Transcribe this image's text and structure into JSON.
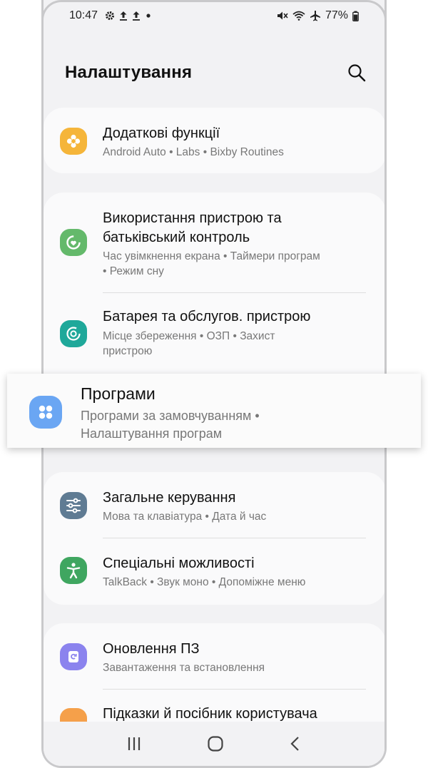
{
  "status_bar": {
    "time": "10:47",
    "battery": "77%"
  },
  "header": {
    "title": "Налаштування"
  },
  "items": {
    "advanced": {
      "title": "Додаткові функції",
      "subtitle": "Android Auto  •  Labs  •  Bixby Routines"
    },
    "wellbeing": {
      "title_line1": "Використання пристрою та",
      "title_line2": "батьківський контроль",
      "subtitle_line1": "Час увімкнення екрана  •  Таймери програм",
      "subtitle_line2": "•  Режим сну"
    },
    "battery": {
      "title": "Батарея та обслугов. пристрою",
      "subtitle_line1": "Місце збереження  •  ОЗП  •  Захист",
      "subtitle_line2": "пристрою"
    },
    "apps": {
      "title": "Програми",
      "subtitle_line1": "Програми за замовчуванням  •",
      "subtitle_line2": "Налаштування програм"
    },
    "general": {
      "title": "Загальне керування",
      "subtitle": "Мова та клавіатура  •  Дата й час"
    },
    "accessibility": {
      "title": "Спеціальні можливості",
      "subtitle": "TalkBack  •  Звук моно  •  Допоміжне меню"
    },
    "update": {
      "title": "Оновлення ПЗ",
      "subtitle": "Завантаження та встановлення"
    },
    "tips": {
      "title": "Підказки й посібник користувача"
    }
  },
  "colors": {
    "advanced": "#f5b53a",
    "wellbeing": "#64b96b",
    "battery": "#1fa89a",
    "apps": "#6aa6f3",
    "general": "#5f7b93",
    "accessibility": "#3fa660",
    "update": "#8b83ee",
    "tips": "#f5a04a"
  }
}
